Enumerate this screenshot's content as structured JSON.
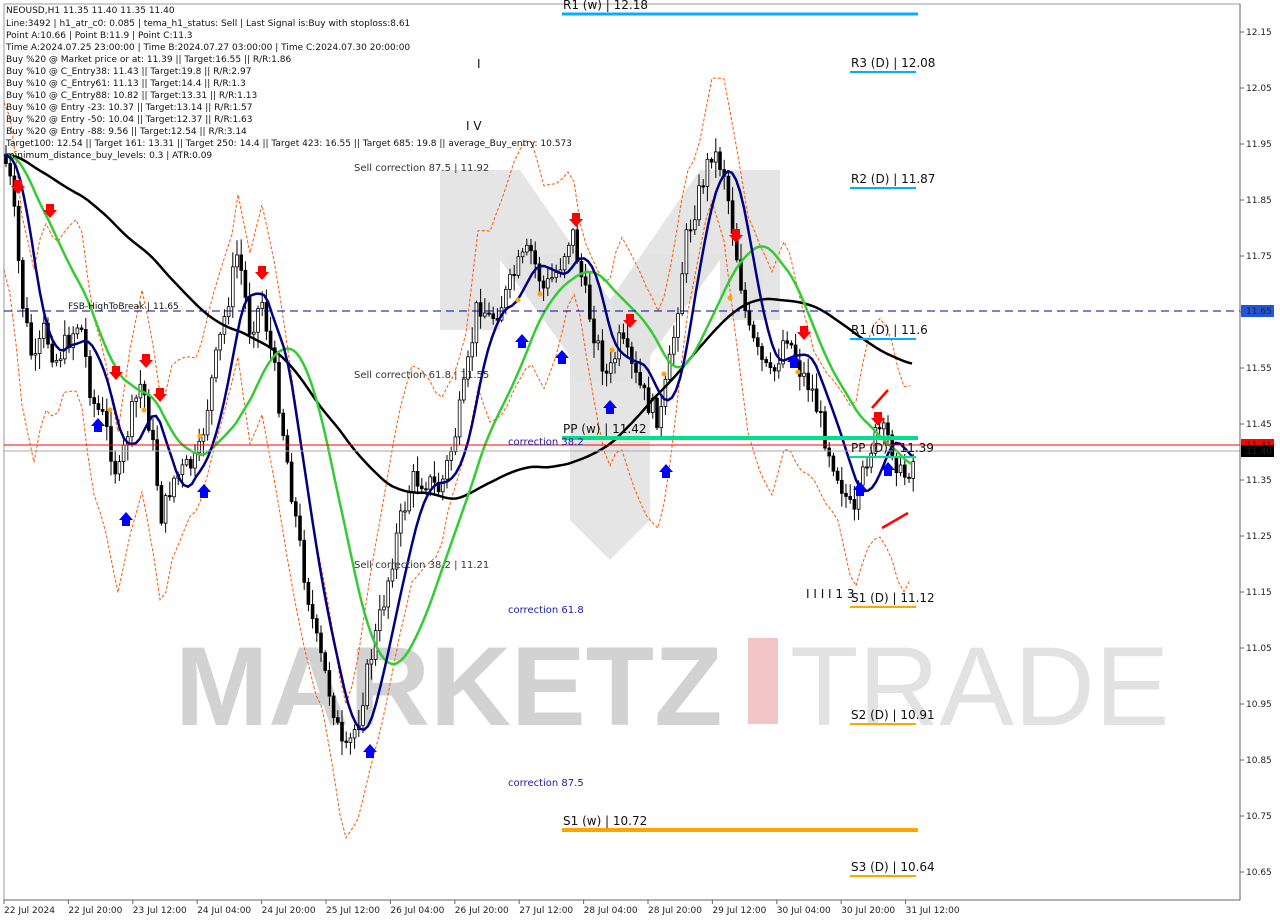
{
  "symbol_header": "NEOUSD,H1  11.35 11.40 11.35 11.40",
  "info_lines": [
    "Line:3492 | h1_atr_c0: 0.085 | tema_h1_status: Sell | Last Signal is:Buy with stoploss:8.61",
    "Point A:10.66 | Point B:11.9 | Point C:11.3",
    "Time A:2024.07.25 23:00:00 | Time B:2024.07.27 03:00:00 | Time C:2024.07.30 20:00:00",
    "Buy %20 @ Market price or at: 11.39 || Target:16.55 || R/R:1.86",
    "Buy %10 @ C_Entry38: 11.43 || Target:19.8 || R/R:2.97",
    "Buy %10 @ C_Entry61: 11.13 || Target:14.4 || R/R:1.3",
    "Buy %10 @ C_Entry88: 10.82 || Target:13.31 || R/R:1.13",
    "Buy %10 @ Entry -23: 10.37 || Target:13.14 || R/R:1.57",
    "Buy %20 @ Entry -50: 10.04 || Target:12.37 || R/R:1.63",
    "Buy %20 @ Entry -88: 9.56 || Target:12.54 || R/R:3.14",
    "Target100: 12.54 || Target 161: 13.31 || Target 250: 14.4 || Target 423: 16.55 || Target 685: 19.8 || average_Buy_entry: 10.573",
    "minimum_distance_buy_levels: 0.3 | ATR:0.09"
  ],
  "price_axis": {
    "ticks": [
      "12.15",
      "12.05",
      "11.95",
      "11.85",
      "11.75",
      "11.65",
      "11.55",
      "11.45",
      "11.35",
      "11.25",
      "11.15",
      "11.05",
      "10.95",
      "10.85",
      "10.75",
      "10.65"
    ],
    "label_fhtb": "11.65",
    "label_red": "11.41",
    "label_current": "11.40"
  },
  "time_axis": {
    "ticks": [
      "22 Jul 2024",
      "22 Jul 20:00",
      "23 Jul 12:00",
      "24 Jul 04:00",
      "24 Jul 20:00",
      "25 Jul 12:00",
      "26 Jul 04:00",
      "26 Jul 20:00",
      "27 Jul 12:00",
      "28 Jul 04:00",
      "28 Jul 20:00",
      "29 Jul 12:00",
      "30 Jul 04:00",
      "30 Jul 20:00",
      "31 Jul 12:00"
    ]
  },
  "levels": {
    "r1_w": "R1 (w) | 12.18",
    "r3_d": "R3 (D) | 12.08",
    "r2_d": "R2 (D) | 11.87",
    "r1_d": "R1 (D) | 11.6",
    "pp_w": "PP (w) | 11.42",
    "pp_d": "PP (D) | 11.39",
    "s1_d": "S1 (D) | 11.12",
    "s2_d": "S2 (D) | 10.91",
    "s1_w": "S1 (w) | 10.72",
    "s3_d": "S3 (D) | 10.64",
    "fhtb": "FSB-HighToBreak | 11.65"
  },
  "annotations": {
    "sell_875": "Sell correction 87.5 | 11.92",
    "sell_618": "Sell correction 61.8 | 11.55",
    "sell_382": "Sell correction 38.2 | 11.21",
    "corr_382": "correction 38.2",
    "corr_618": "correction 61.8",
    "corr_875": "correction 87.5",
    "wave_iv": "I V",
    "wave_i": "I",
    "wave_iiii": "I I I I 1 3"
  },
  "watermark": {
    "left": "MARKETZ",
    "right": "TRADE"
  },
  "colors": {
    "background": "#ffffff",
    "ma_black": "#000000",
    "ma_green": "#33cc33",
    "ma_navy": "#000080",
    "envelope": "#ff5500",
    "level_cyan": "#00b0ff",
    "level_green": "#00e08a",
    "level_orange": "#ffa500",
    "signal_red": "#ff0000",
    "signal_blue": "#0000ff",
    "fhtb_line": "#0000aa",
    "red_line": "#ff0000",
    "current_label": "#000000"
  }
}
